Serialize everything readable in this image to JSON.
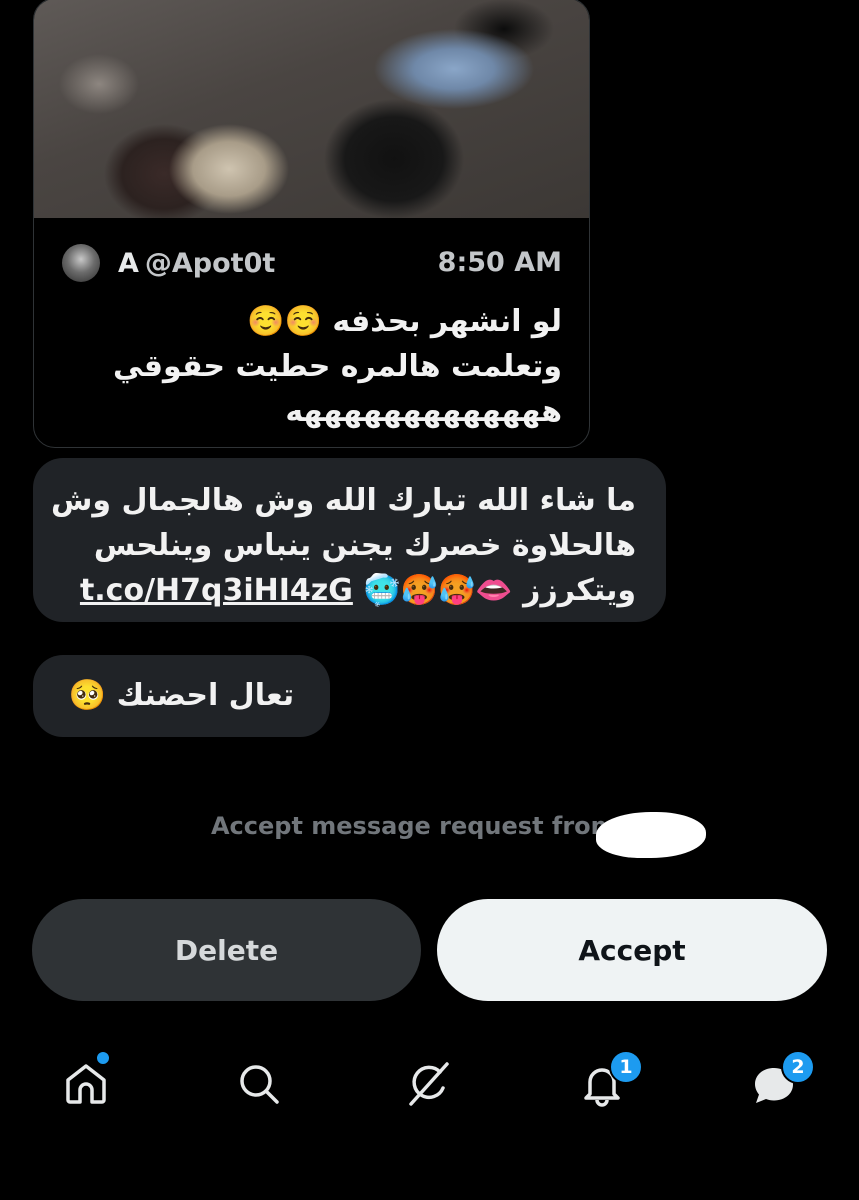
{
  "quote": {
    "name": "A",
    "handle": "@Apot0t",
    "time": "8:50 AM",
    "lines": [
      "لو انشهر بحذفه ☺️☺️",
      "وتعلمت هالمره حطيت حقوقي",
      "هههههههههههههه"
    ]
  },
  "messages": [
    {
      "lines": [
        "ما شاء الله تبارك الله وش هالجمال وش",
        "هالحلاوة خصرك يجنن ينباس وينلحس",
        "ويتكرزز 👄🥵🥵🥶"
      ],
      "link": "t.co/H7q3iHI4zG"
    },
    {
      "text": "تعال احضنك 🥺"
    }
  ],
  "request": {
    "text": "Accept message request from @"
  },
  "buttons": {
    "delete": "Delete",
    "accept": "Accept"
  },
  "nav": {
    "items": [
      "home-icon",
      "search-icon",
      "grok-icon",
      "bell-icon",
      "messages-icon"
    ],
    "notifications_badge": "1",
    "messages_badge": "2",
    "accent": "#1d9bf0"
  }
}
